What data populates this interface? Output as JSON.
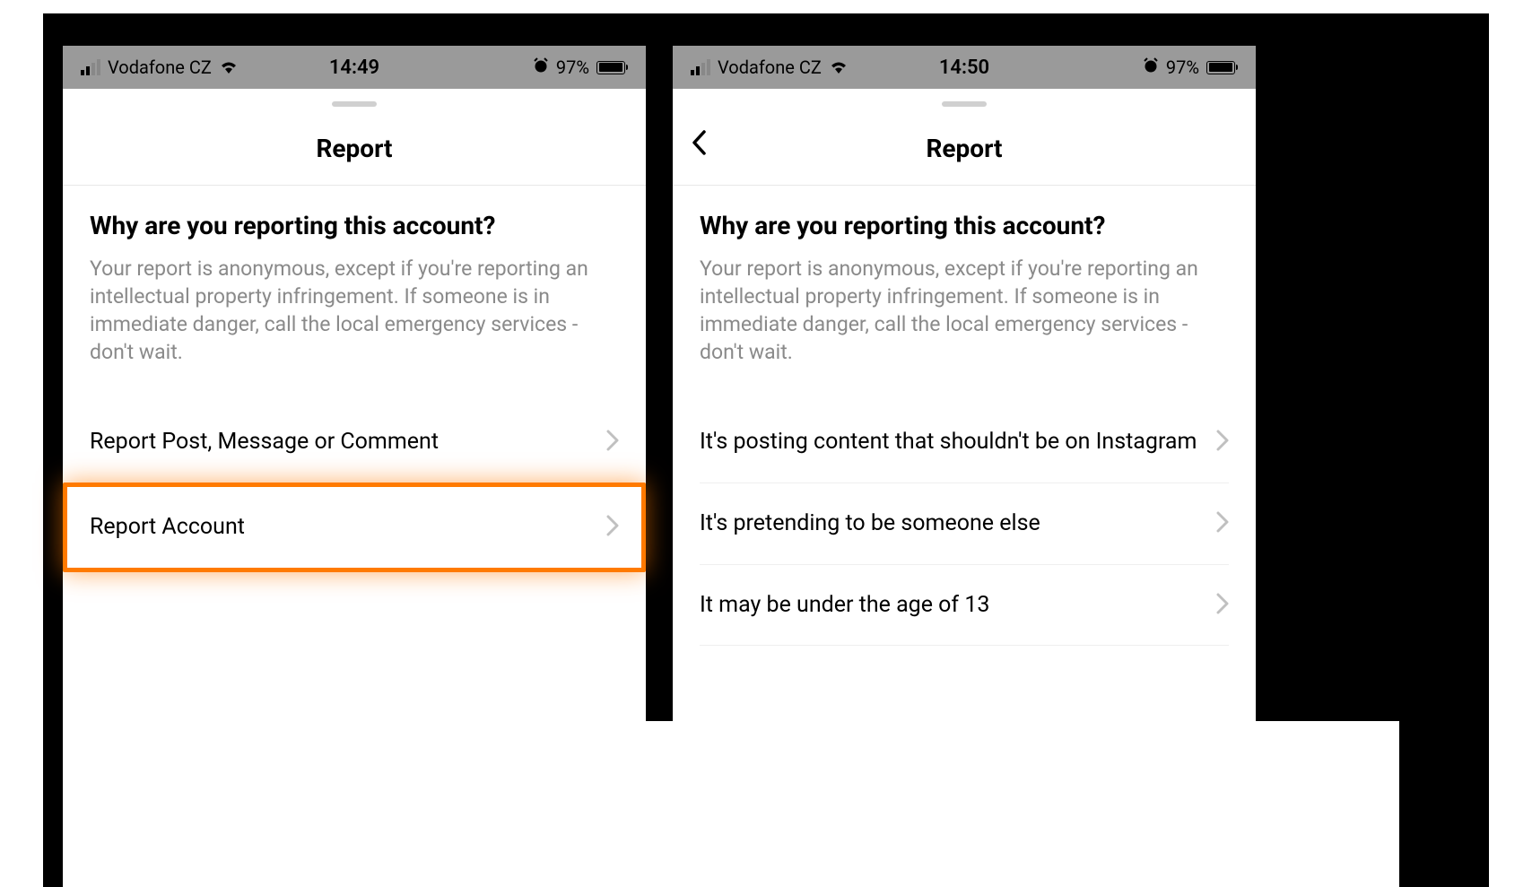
{
  "screens": {
    "left": {
      "status_bar": {
        "carrier": "Vodafone CZ",
        "time": "14:49",
        "battery_percent": "97%"
      },
      "sheet": {
        "title": "Report",
        "has_back": false,
        "heading": "Why are you reporting this account?",
        "description": "Your report is anonymous, except if you're reporting an intellectual property infringement. If someone is in immediate danger, call the local emergency services - don't wait.",
        "options": [
          {
            "label": "Report Post, Message or Comment",
            "highlighted": false
          },
          {
            "label": "Report Account",
            "highlighted": true
          }
        ]
      }
    },
    "right": {
      "status_bar": {
        "carrier": "Vodafone CZ",
        "time": "14:50",
        "battery_percent": "97%"
      },
      "sheet": {
        "title": "Report",
        "has_back": true,
        "heading": "Why are you reporting this account?",
        "description": "Your report is anonymous, except if you're reporting an intellectual property infringement. If someone is in immediate danger, call the local emergency services - don't wait.",
        "options": [
          {
            "label": "It's posting content that shouldn't be on Instagram",
            "highlighted": false
          },
          {
            "label": "It's pretending to be someone else",
            "highlighted": false
          },
          {
            "label": "It may be under the age of 13",
            "highlighted": false
          }
        ]
      }
    }
  }
}
